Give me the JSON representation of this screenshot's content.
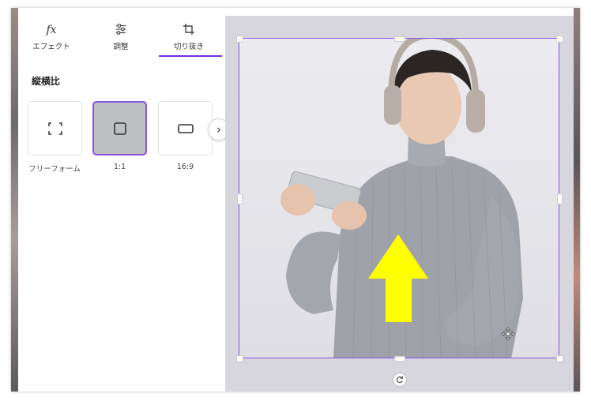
{
  "tabs": [
    {
      "label": "エフェクト",
      "icon": "fx-icon",
      "active": false
    },
    {
      "label": "調整",
      "icon": "sliders-icon",
      "active": false
    },
    {
      "label": "切り抜き",
      "icon": "crop-icon",
      "active": true
    }
  ],
  "fx_glyph": "fx",
  "section_title": "縦横比",
  "ratios": [
    {
      "label": "フリーフォーム",
      "icon": "freeform-icon",
      "selected": false
    },
    {
      "label": "1:1",
      "icon": "square-icon",
      "selected": true
    },
    {
      "label": "16:9",
      "icon": "wide-rectangle-icon",
      "selected": false
    }
  ],
  "next_glyph": "›",
  "colors": {
    "accent": "#8b52e8",
    "arrow": "#ffff00",
    "canvas_bg": "#d6d6dc"
  }
}
